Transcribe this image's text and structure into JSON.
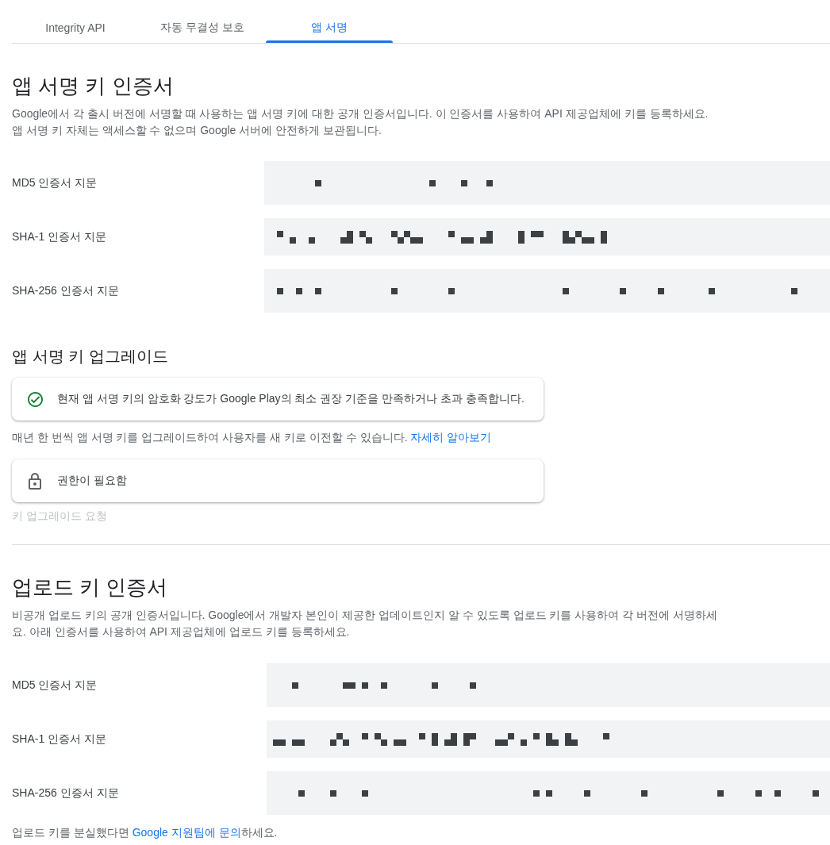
{
  "tabs": [
    {
      "label": "Integrity API",
      "selected": false
    },
    {
      "label": "자동 무결성 보호",
      "selected": false
    },
    {
      "label": "앱 서명",
      "selected": true
    }
  ],
  "app_signing_certificate": {
    "title": "앱 서명 키 인증서",
    "description": "Google에서 각 출시 버전에 서명할 때 사용하는 앱 서명 키에 대한 공개 인증서입니다. 이 인증서를 사용하여 API 제공업체에 키를 등록하세요. 앱 서명 키 자체는 액세스할 수 없으며 Google 서버에 안전하게 보관됩니다.",
    "fingerprints": [
      {
        "label": "MD5 인증서 지문"
      },
      {
        "label": "SHA-1 인증서 지문"
      },
      {
        "label": "SHA-256 인증서 지문"
      }
    ]
  },
  "key_upgrade": {
    "title": "앱 서명 키 업그레이드",
    "status_card": {
      "kind": "success",
      "text": "현재 앱 서명 키의 암호화 강도가 Google Play의 최소 권장 기준을 만족하거나 초과 충족합니다."
    },
    "note": {
      "text": "매년 한 번씩 앱 서명 키를 업그레이드하여 사용자를 새 키로 이전할 수 있습니다.",
      "link": "자세히 알아보기"
    },
    "permission_card": {
      "kind": "locked",
      "text": "권한이 필요함"
    },
    "request_button": {
      "label": "키 업그레이드 요청",
      "disabled": true
    }
  },
  "upload_certificate": {
    "title": "업로드 키 인증서",
    "description": "비공개 업로드 키의 공개 인증서입니다. Google에서 개발자 본인이 제공한 업데이트인지 알 수 있도록 업로드 키를 사용하여 각 버전에 서명하세요. 아래 인증서를 사용하여 API 제공업체에 업로드 키를 등록하세요.",
    "fingerprints": [
      {
        "label": "MD5 인증서 지문"
      },
      {
        "label": "SHA-1 인증서 지문"
      },
      {
        "label": "SHA-256 인증서 지문"
      }
    ]
  },
  "footer_note": {
    "text_before": "업로드 키를 분실했다면",
    "link": "Google 지원팀에 문의",
    "text_after": "하세요."
  }
}
